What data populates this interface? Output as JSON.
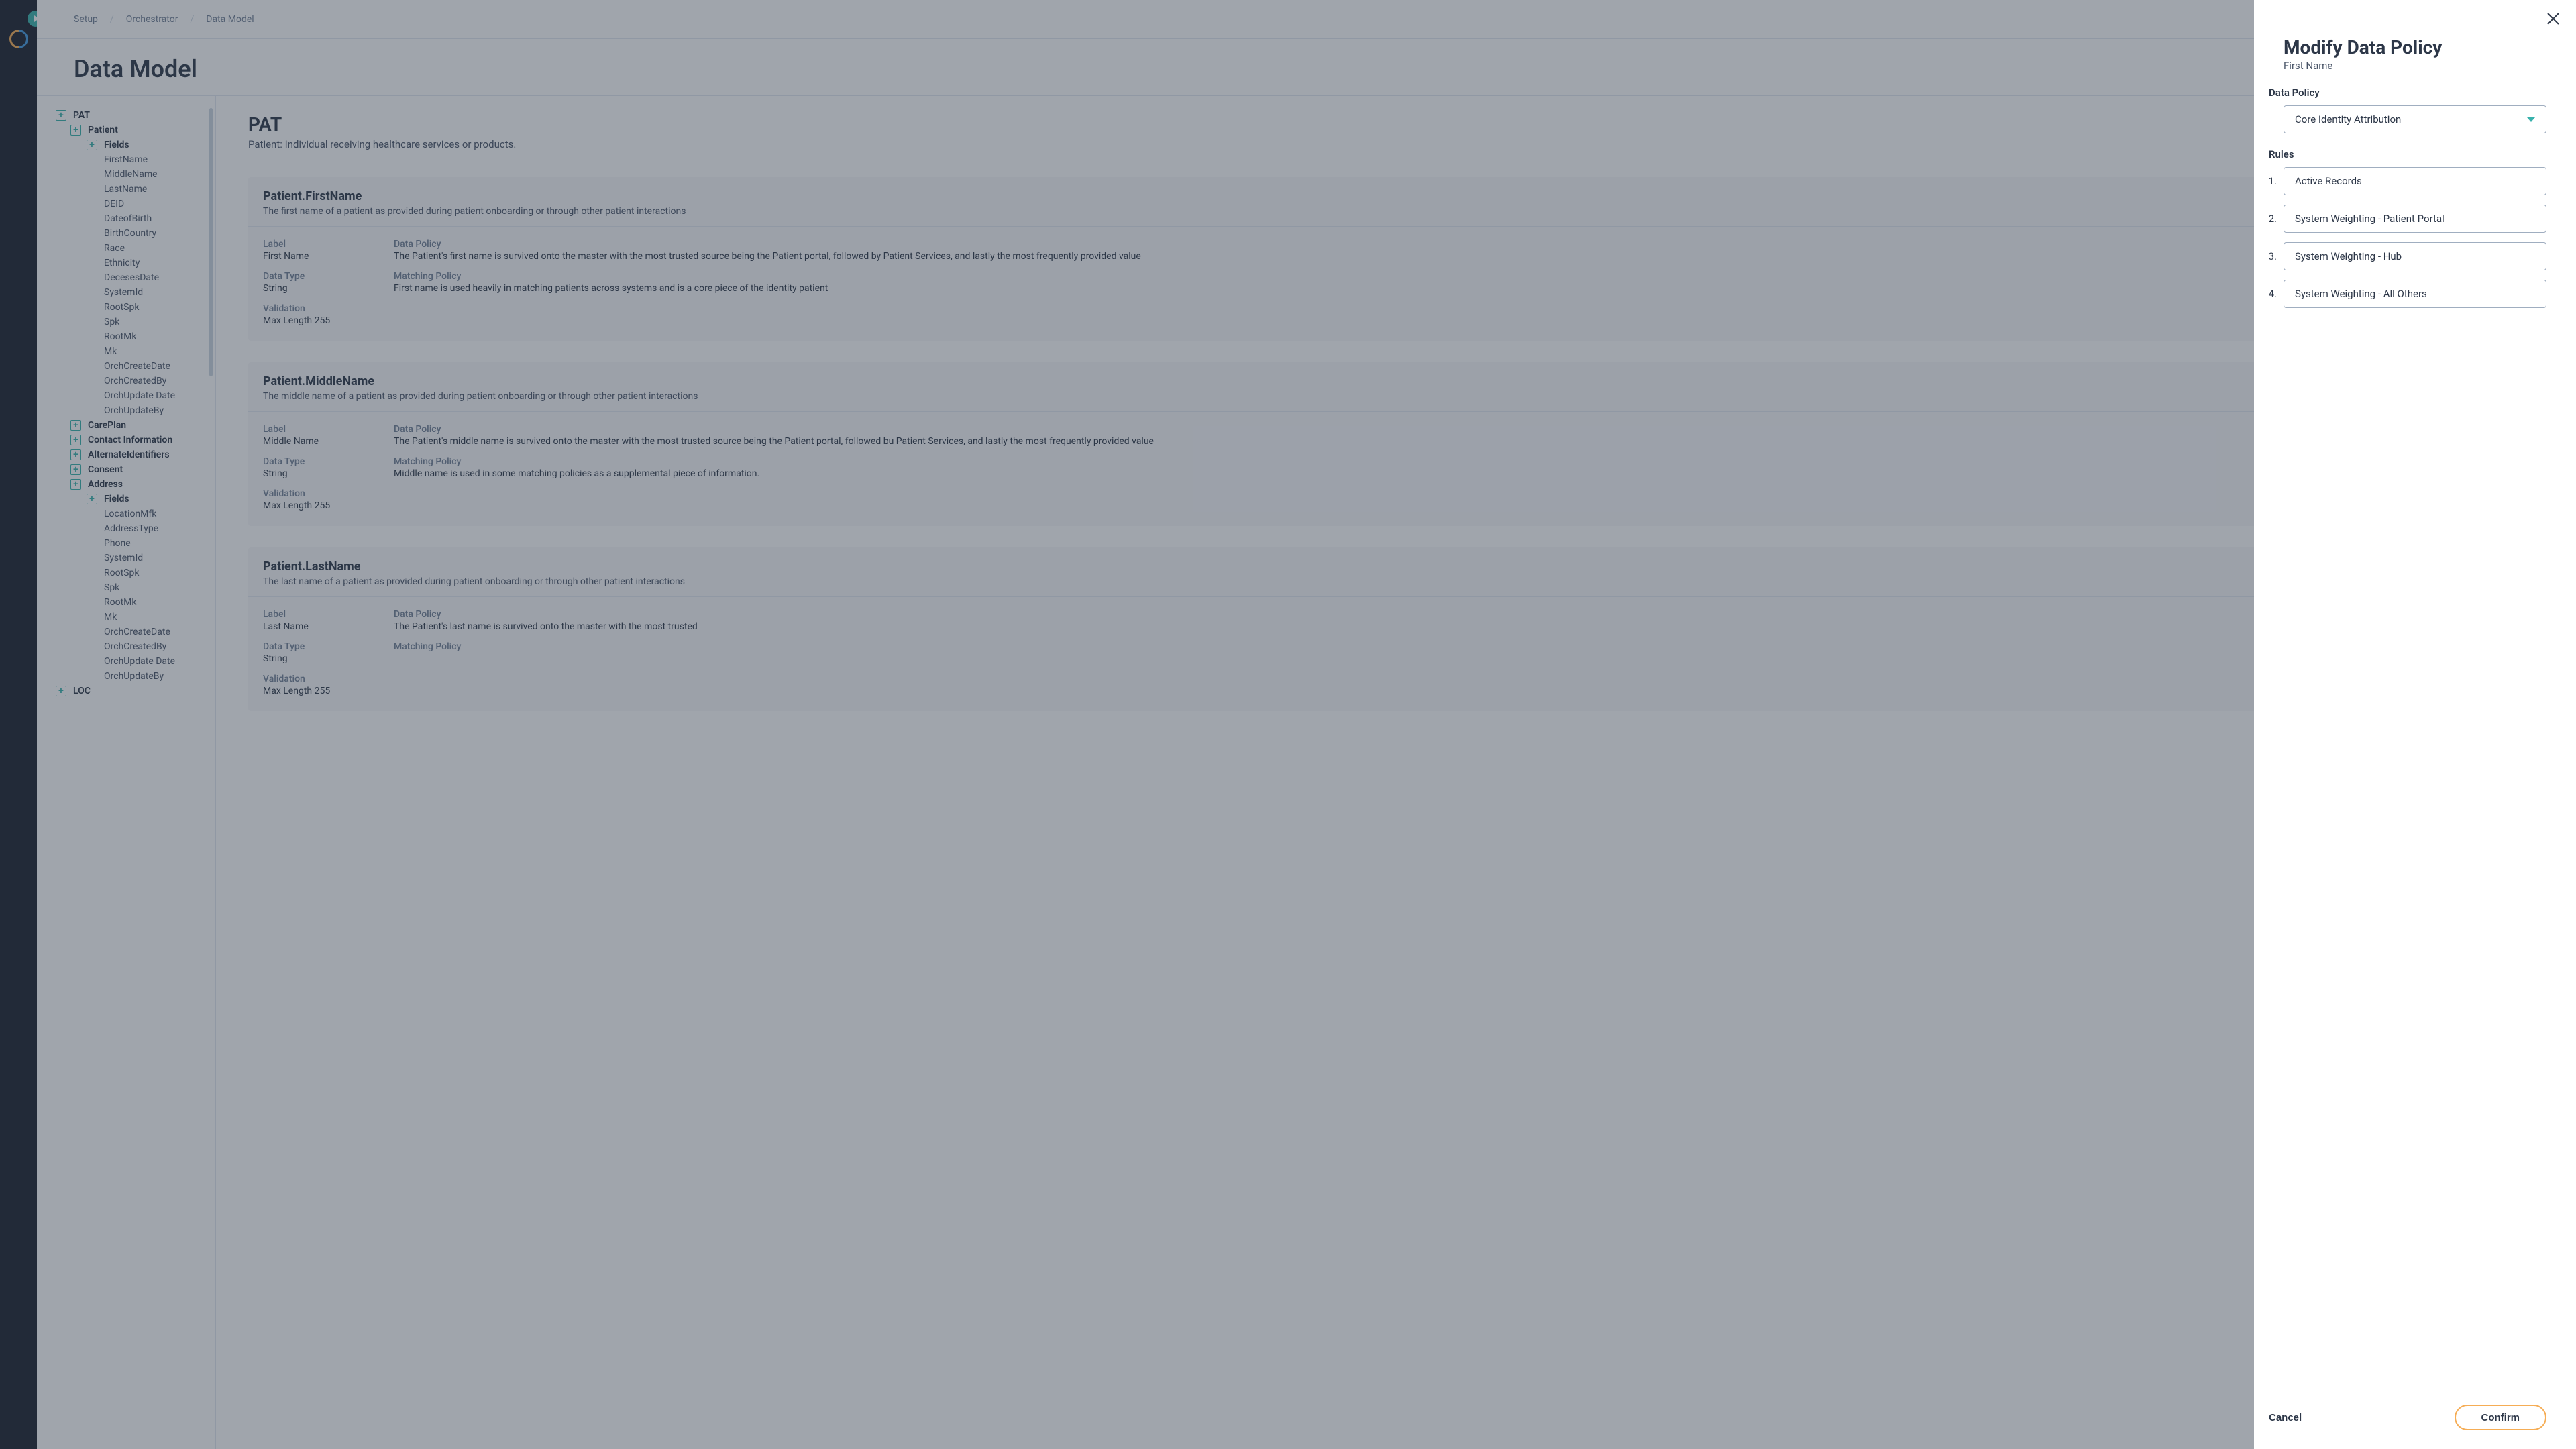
{
  "breadcrumb": {
    "a": "Setup",
    "b": "Orchestrator",
    "c": "Data Model"
  },
  "page_title": "Data Model",
  "tree": {
    "pat": "PAT",
    "patient": "Patient",
    "fields_label": "Fields",
    "patient_fields": [
      "FirstName",
      "MiddleName",
      "LastName",
      "DEID",
      "DateofBirth",
      "BirthCountry",
      "Race",
      "Ethnicity",
      "DecesesDate",
      "SystemId",
      "RootSpk",
      "Spk",
      "RootMk",
      "Mk",
      "OrchCreateDate",
      "OrchCreatedBy",
      "OrchUpdate Date",
      "OrchUpdateBy"
    ],
    "sections": [
      "CarePlan",
      "Contact Information",
      "AlternateIdentifiers",
      "Consent",
      "Address"
    ],
    "address_fields": [
      "LocationMfk",
      "AddressType",
      "Phone",
      "SystemId",
      "RootSpk",
      "Spk",
      "RootMk",
      "Mk",
      "OrchCreateDate",
      "OrchCreatedBy",
      "OrchUpdate Date",
      "OrchUpdateBy"
    ],
    "loc": "LOC"
  },
  "detail": {
    "heading": "PAT",
    "heading_sub": "Patient: Individual receiving healthcare services or products.",
    "cards": [
      {
        "title": "Patient.FirstName",
        "desc": "The first name of a patient as provided during patient onboarding or through other patient interactions",
        "label_l": "Label",
        "label_v": "First Name",
        "dtype_l": "Data Type",
        "dtype_v": "String",
        "valid_l": "Validation",
        "valid_v": "Max Length 255",
        "dpol_l": "Data Policy",
        "dpol_v": "The Patient's first name is survived onto the master with the most trusted source being the Patient portal, followed by Patient Services, and lastly the most frequently provided value",
        "mpol_l": "Matching Policy",
        "mpol_v": "First name is used heavily in matching patients across systems and is a core piece of the identity patient"
      },
      {
        "title": "Patient.MiddleName",
        "desc": "The middle name of a patient as provided during patient onboarding or through other patient interactions",
        "label_l": "Label",
        "label_v": "Middle Name",
        "dtype_l": "Data Type",
        "dtype_v": "String",
        "valid_l": "Validation",
        "valid_v": "Max Length 255",
        "dpol_l": "Data Policy",
        "dpol_v": "The Patient's middle name is survived onto the master with the most trusted source being the Patient portal, followed bu Patient Services, and lastly the most frequently provided value",
        "mpol_l": "Matching Policy",
        "mpol_v": "Middle name is used in some matching policies as a supplemental piece of information."
      },
      {
        "title": "Patient.LastName",
        "desc": "The last name of a patient as provided during patient onboarding or through other patient interactions",
        "label_l": "Label",
        "label_v": "Last Name",
        "dtype_l": "Data Type",
        "dtype_v": "String",
        "valid_l": "Validation",
        "valid_v": "Max Length 255",
        "dpol_l": "Data Policy",
        "dpol_v": "The Patient's last name is survived onto the master with the most trusted",
        "mpol_l": "Matching Policy",
        "mpol_v": ""
      }
    ]
  },
  "panel": {
    "title": "Modify Data Policy",
    "subtitle": "First Name",
    "dp_label": "Data Policy",
    "dp_value": "Core Identity Attribution",
    "rules_label": "Rules",
    "rules": [
      "Active Records",
      "System Weighting - Patient Portal",
      "System Weighting - Hub",
      "System Weighting - All Others"
    ],
    "cancel": "Cancel",
    "confirm": "Confirm"
  }
}
